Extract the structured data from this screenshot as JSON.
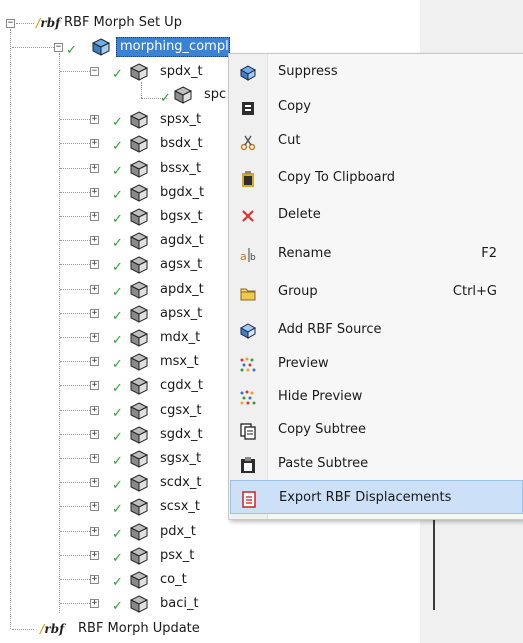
{
  "tree": {
    "root": {
      "label": "RBF Morph Set Up",
      "logo": "rbf"
    },
    "selected": {
      "label": "morphing_complete"
    },
    "spdx_child": {
      "label": "spc"
    },
    "nodes": [
      "spdx_t",
      "spsx_t",
      "bsdx_t",
      "bssx_t",
      "bgdx_t",
      "bgsx_t",
      "agdx_t",
      "agsx_t",
      "apdx_t",
      "apsx_t",
      "mdx_t",
      "msx_t",
      "cgdx_t",
      "cgsx_t",
      "sgdx_t",
      "sgsx_t",
      "scdx_t",
      "scsx_t",
      "pdx_t",
      "psx_t",
      "co_t",
      "baci_t"
    ],
    "update": {
      "label": "RBF Morph Update",
      "logo": "rbf"
    }
  },
  "context_menu": {
    "items": [
      {
        "label": "Suppress",
        "icon": "suppress-icon",
        "shortcut": ""
      },
      {
        "label": "Copy",
        "icon": "copy-icon",
        "shortcut": ""
      },
      {
        "label": "Cut",
        "icon": "cut-icon",
        "shortcut": ""
      },
      {
        "label": "Copy To Clipboard",
        "icon": "clipboard-icon",
        "shortcut": ""
      },
      {
        "label": "Delete",
        "icon": "delete-icon",
        "shortcut": ""
      },
      {
        "label": "Rename",
        "icon": "rename-icon",
        "shortcut": "F2"
      },
      {
        "label": "Group",
        "icon": "folder-icon",
        "shortcut": "Ctrl+G"
      },
      {
        "label": "Add RBF Source",
        "icon": "add-source-icon",
        "shortcut": ""
      },
      {
        "label": "Preview",
        "icon": "preview-icon",
        "shortcut": ""
      },
      {
        "label": "Hide Preview",
        "icon": "hide-preview-icon",
        "shortcut": ""
      },
      {
        "label": "Copy Subtree",
        "icon": "copy-subtree-icon",
        "shortcut": ""
      },
      {
        "label": "Paste Subtree",
        "icon": "paste-subtree-icon",
        "shortcut": ""
      },
      {
        "label": "Export RBF Displacements",
        "icon": "export-icon",
        "shortcut": ""
      }
    ],
    "highlighted_index": 12
  },
  "colors": {
    "selection": "#3a82d6",
    "check": "#2fa02f",
    "menu_highlight": "#cce0f7",
    "delete": "#e03030"
  }
}
